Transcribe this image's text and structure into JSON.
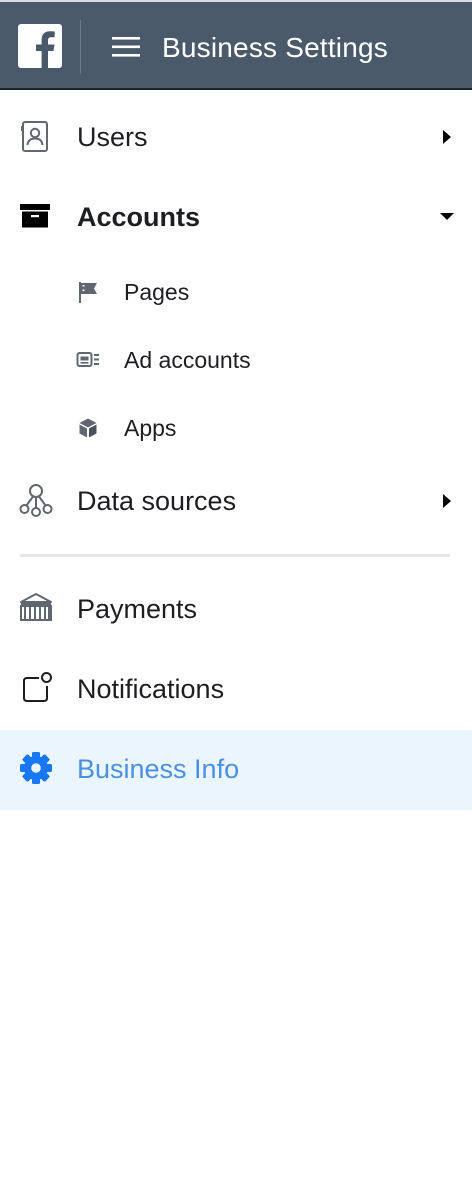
{
  "header": {
    "title": "Business Settings",
    "logo_icon": "facebook-logo-icon",
    "menu_icon": "hamburger-menu-icon",
    "background_color": "#4b5a6b"
  },
  "nav": {
    "users": {
      "label": "Users",
      "icon": "id-card-icon",
      "arrow": "caret-right-icon"
    },
    "accounts": {
      "label": "Accounts",
      "icon": "archive-box-icon",
      "arrow": "caret-down-icon",
      "expanded": true,
      "children": [
        {
          "label": "Pages",
          "icon": "flag-icon"
        },
        {
          "label": "Ad accounts",
          "icon": "ad-account-icon"
        },
        {
          "label": "Apps",
          "icon": "cube-icon"
        }
      ]
    },
    "data_sources": {
      "label": "Data sources",
      "icon": "nodes-icon",
      "arrow": "caret-right-icon"
    },
    "payments": {
      "label": "Payments",
      "icon": "bank-icon"
    },
    "notifications": {
      "label": "Notifications",
      "icon": "notification-icon"
    },
    "business_info": {
      "label": "Business Info",
      "icon": "gear-icon",
      "active": true
    }
  },
  "colors": {
    "active_text": "#4a90e2",
    "active_background": "#ebf5fe"
  }
}
